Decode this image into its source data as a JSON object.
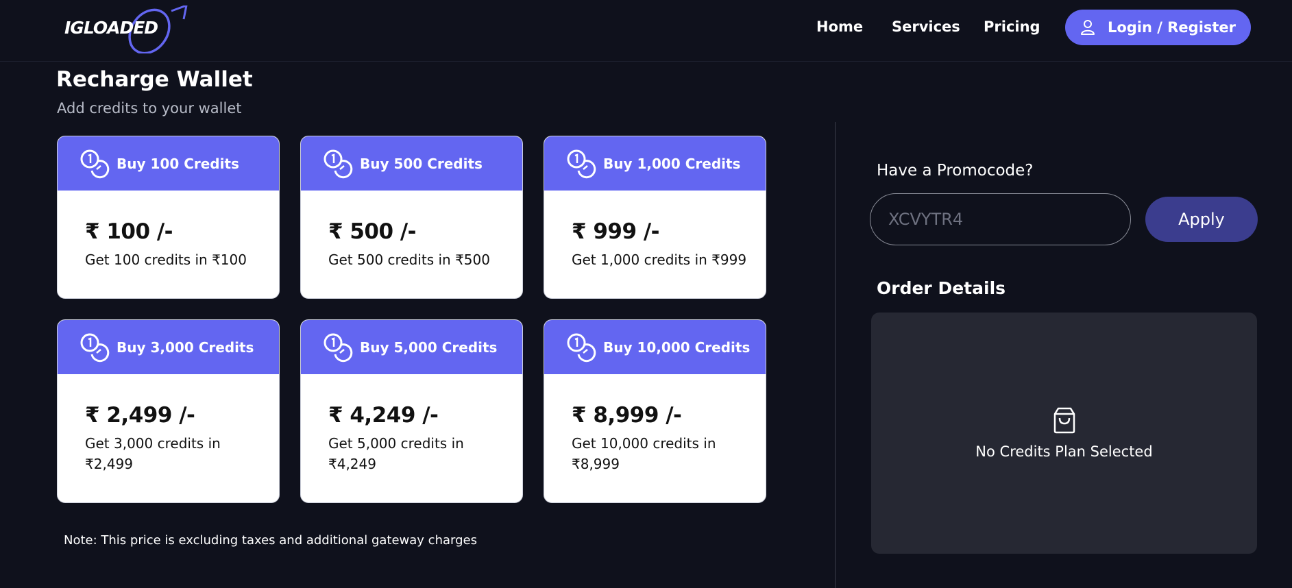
{
  "header": {
    "logo_text": "IGLOADED",
    "nav": [
      {
        "label": "Home"
      },
      {
        "label": "Services"
      },
      {
        "label": "Pricing"
      }
    ],
    "login_label": "Login / Register"
  },
  "page": {
    "title": "Recharge Wallet",
    "subtitle": "Add credits to your wallet"
  },
  "plans": [
    {
      "label": "Buy 100 Credits",
      "price": "₹ 100 /-",
      "desc": "Get 100 credits in ₹100"
    },
    {
      "label": "Buy 500 Credits",
      "price": "₹ 500 /-",
      "desc": "Get 500 credits in ₹500"
    },
    {
      "label": "Buy 1,000 Credits",
      "price": "₹ 999 /-",
      "desc": "Get 1,000 credits in ₹999"
    },
    {
      "label": "Buy 3,000 Credits",
      "price": "₹ 2,499 /-",
      "desc": "Get 3,000 credits in ₹2,499"
    },
    {
      "label": "Buy 5,000 Credits",
      "price": "₹ 4,249 /-",
      "desc": "Get 5,000 credits in ₹4,249"
    },
    {
      "label": "Buy 10,000 Credits",
      "price": "₹ 8,999 /-",
      "desc": "Get 10,000 credits in ₹8,999"
    }
  ],
  "note": "Note: This price is excluding taxes and additional gateway charges",
  "promo": {
    "label": "Have a Promocode?",
    "placeholder": "XCVYTR4",
    "apply_label": "Apply"
  },
  "order": {
    "title": "Order Details",
    "empty_text": "No Credits Plan Selected",
    "icon": "shopping-bag-icon"
  },
  "colors": {
    "background": "#0f111c",
    "accent": "#6366f1",
    "apply_button": "#3b3d8e",
    "order_box": "#262833"
  },
  "icons": {
    "card": "coins-icon",
    "login": "user-icon"
  }
}
